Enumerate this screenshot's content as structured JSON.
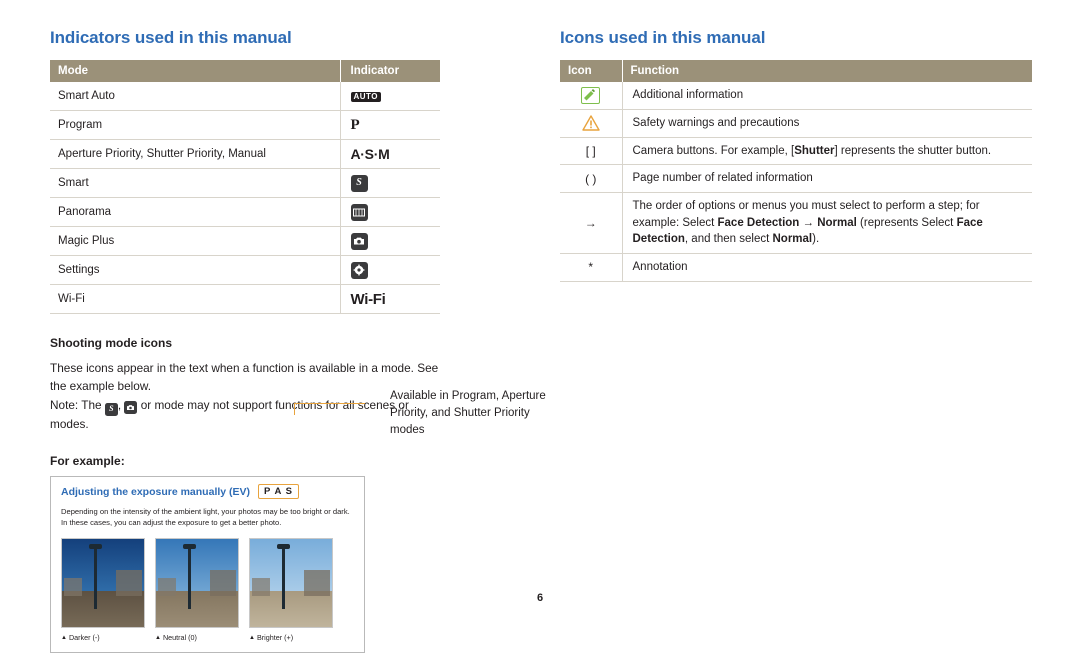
{
  "left": {
    "title": "Indicators used in this manual",
    "table": {
      "headers": [
        "Mode",
        "Indicator"
      ],
      "rows": [
        {
          "mode": "Smart Auto",
          "indicator": "AUTO",
          "glyph": "auto-badge"
        },
        {
          "mode": "Program",
          "indicator": "P",
          "glyph": "letter-p"
        },
        {
          "mode": "Aperture Priority, Shutter Priority, Manual",
          "indicator": "A·S·M",
          "glyph": "letters-asm"
        },
        {
          "mode": "Smart",
          "indicator": "S",
          "glyph": "smart-badge"
        },
        {
          "mode": "Panorama",
          "indicator": "",
          "glyph": "panorama-badge"
        },
        {
          "mode": "Magic Plus",
          "indicator": "",
          "glyph": "magic-plus-badge"
        },
        {
          "mode": "Settings",
          "indicator": "",
          "glyph": "settings-gear-badge"
        },
        {
          "mode": "Wi-Fi",
          "indicator": "Wi-Fi",
          "glyph": "wifi-text"
        }
      ]
    },
    "shooting_heading": "Shooting mode icons",
    "shooting_text_1": "These icons appear in the text when a function is available in a mode. See the example below.",
    "shooting_note_prefix": "Note: The ",
    "shooting_note_suffix": " or mode may not support functions for all scenes or modes.",
    "for_example_heading": "For example:",
    "example": {
      "title": "Adjusting the exposure manually (EV)",
      "pas": "P A S",
      "description": "Depending on the intensity of the ambient light, your photos may be too bright or dark. In these cases, you can adjust the exposure to get a better photo.",
      "thumbs": [
        {
          "caption": "Darker (-)",
          "sky": "#1f4f8f",
          "ground": "#6d5f4c"
        },
        {
          "caption": "Neutral (0)",
          "sky": "#3e7fc0",
          "ground": "#8f8069"
        },
        {
          "caption": "Brighter (+)",
          "sky": "#7fb4dd",
          "ground": "#b0a288"
        }
      ]
    },
    "callout": "Available in Program, Aperture Priority, and Shutter Priority modes"
  },
  "right": {
    "title": "Icons used in this manual",
    "table": {
      "headers": [
        "Icon",
        "Function"
      ],
      "rows": [
        {
          "icon": "note-pencil-badge",
          "icon_text": "",
          "function": "Additional information"
        },
        {
          "icon": "warning-triangle",
          "icon_text": "",
          "function": "Safety warnings and precautions"
        },
        {
          "icon": "brackets",
          "icon_text": "[ ]",
          "function_parts": [
            "Camera buttons. For example, [",
            "Shutter",
            "] represents the shutter button."
          ]
        },
        {
          "icon": "parentheses",
          "icon_text": "( )",
          "function": "Page number of related information"
        },
        {
          "icon": "arrow-right",
          "icon_text": "→",
          "function_parts": [
            "The order of options or menus you must select to perform a step; for example: Select ",
            "Face Detection",
            " → ",
            "Normal",
            " (represents Select ",
            "Face Detection",
            ", and then select ",
            "Normal",
            ")."
          ]
        },
        {
          "icon": "asterisk",
          "icon_text": "*",
          "function": "Annotation"
        }
      ]
    }
  },
  "footer": {
    "page_number": "6"
  }
}
